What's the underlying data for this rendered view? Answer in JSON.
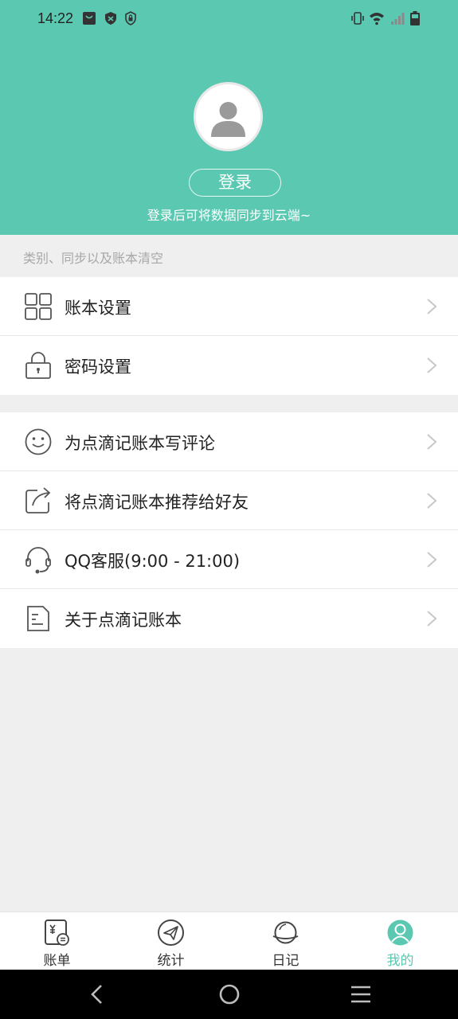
{
  "status_bar": {
    "time": "14:22",
    "icons": [
      "shopping-bag-icon",
      "shield-icon",
      "security-icon",
      "vibrate-icon",
      "wifi-icon",
      "signal-icon",
      "battery-icon"
    ]
  },
  "profile": {
    "avatar_icon": "user-avatar-icon",
    "login_label": "登录",
    "login_hint": "登录后可将数据同步到云端~"
  },
  "section_label": "类别、同步以及账本清空",
  "settings": [
    {
      "label": "账本设置",
      "icon": "grid-icon"
    },
    {
      "label": "密码设置",
      "icon": "lock-icon"
    }
  ],
  "misc": [
    {
      "label": "为点滴记账本写评论",
      "icon": "smile-icon"
    },
    {
      "label": "将点滴记账本推荐给好友",
      "icon": "share-icon"
    },
    {
      "label": "QQ客服(9:00 - 21:00)",
      "icon": "headset-icon"
    },
    {
      "label": "关于点滴记账本",
      "icon": "document-icon"
    }
  ],
  "tabs": [
    {
      "label": "账单",
      "icon": "bill-icon",
      "active": false
    },
    {
      "label": "统计",
      "icon": "paper-plane-icon",
      "active": false
    },
    {
      "label": "日记",
      "icon": "planet-icon",
      "active": false
    },
    {
      "label": "我的",
      "icon": "profile-icon",
      "active": true
    }
  ],
  "colors": {
    "accent": "#5bc8b2",
    "background": "#efefef"
  }
}
